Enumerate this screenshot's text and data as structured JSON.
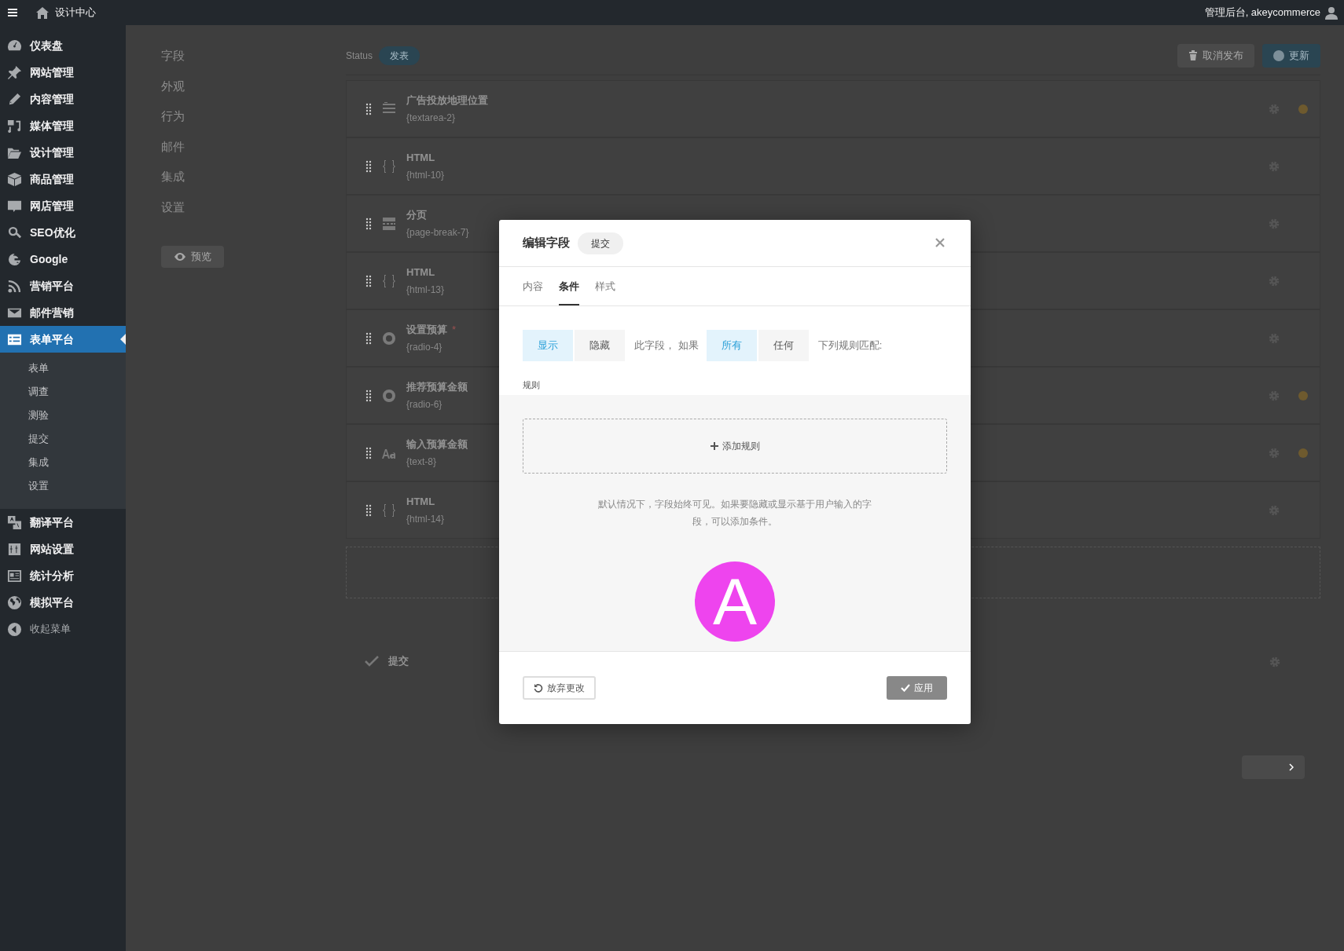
{
  "topbar": {
    "site_title": "设计中心",
    "user": "管理后台, akeycommerce"
  },
  "sidebar": {
    "items": [
      {
        "label": "仪表盘",
        "selected": false
      },
      {
        "label": "网站管理",
        "selected": false
      },
      {
        "label": "内容管理",
        "selected": false
      },
      {
        "label": "媒体管理",
        "selected": false
      },
      {
        "label": "设计管理",
        "selected": false
      },
      {
        "label": "商品管理",
        "selected": false
      },
      {
        "label": "网店管理",
        "selected": false
      },
      {
        "label": "SEO优化",
        "selected": false
      },
      {
        "label": "Google",
        "selected": false
      },
      {
        "label": "营销平台",
        "selected": false
      },
      {
        "label": "邮件营销",
        "selected": false
      },
      {
        "label": "表单平台",
        "selected": true,
        "children": [
          {
            "label": "表单"
          },
          {
            "label": "调查"
          },
          {
            "label": "测验"
          },
          {
            "label": "提交"
          },
          {
            "label": "集成"
          },
          {
            "label": "设置"
          }
        ]
      },
      {
        "label": "翻译平台",
        "selected": false
      },
      {
        "label": "网站设置",
        "selected": false
      },
      {
        "label": "统计分析",
        "selected": false
      },
      {
        "label": "模拟平台",
        "selected": false
      }
    ],
    "collapse": "收起菜单"
  },
  "editor": {
    "nav": [
      {
        "label": "字段"
      },
      {
        "label": "外观"
      },
      {
        "label": "行为"
      },
      {
        "label": "邮件"
      },
      {
        "label": "集成"
      },
      {
        "label": "设置"
      }
    ],
    "preview_button": "预览",
    "status_label": "Status",
    "status_badge": "发表",
    "unpublish_button": "取消发布",
    "update_button": "更新",
    "fields": [
      {
        "kind": "textarea",
        "title": "广告投放地理位置",
        "id": "{textarea-2}",
        "required": false,
        "flagged": true
      },
      {
        "kind": "html",
        "title": "HTML",
        "id": "{html-10}",
        "required": false,
        "flagged": false
      },
      {
        "kind": "page-break",
        "title": "分页",
        "id": "{page-break-7}",
        "required": false,
        "flagged": false
      },
      {
        "kind": "html",
        "title": "HTML",
        "id": "{html-13}",
        "required": false,
        "flagged": false
      },
      {
        "kind": "radio",
        "title": "设置预算",
        "id": "{radio-4}",
        "required": true,
        "flagged": false
      },
      {
        "kind": "radio",
        "title": "推荐预算金额",
        "id": "{radio-6}",
        "required": false,
        "flagged": true
      },
      {
        "kind": "text",
        "title": "输入预算金额",
        "id": "{text-8}",
        "required": false,
        "flagged": true
      },
      {
        "kind": "html",
        "title": "HTML",
        "id": "{html-14}",
        "required": false,
        "flagged": false
      }
    ],
    "submit_row": "提交",
    "required_mark": "*"
  },
  "modal": {
    "title": "编辑字段",
    "badge": "提交",
    "tabs": [
      {
        "label": "内容",
        "selected": false
      },
      {
        "label": "条件",
        "selected": true
      },
      {
        "label": "样式",
        "selected": false
      }
    ],
    "visibility_options": [
      {
        "label": "显示",
        "selected": true
      },
      {
        "label": "隐藏",
        "selected": false
      }
    ],
    "text_before_match": "此字段， 如果",
    "match_options": [
      {
        "label": "所有",
        "selected": true
      },
      {
        "label": "任何",
        "selected": false
      }
    ],
    "text_after_match": "下列规则匹配:",
    "rules_label": "规则",
    "add_rule": "添加规则",
    "help": "默认情况下，字段始终可见。如果要隐藏或显示基于用户输入的字段，可以添加条件。",
    "logo_letter": "A",
    "discard_button": "放弃更改",
    "apply_button": "应用"
  }
}
